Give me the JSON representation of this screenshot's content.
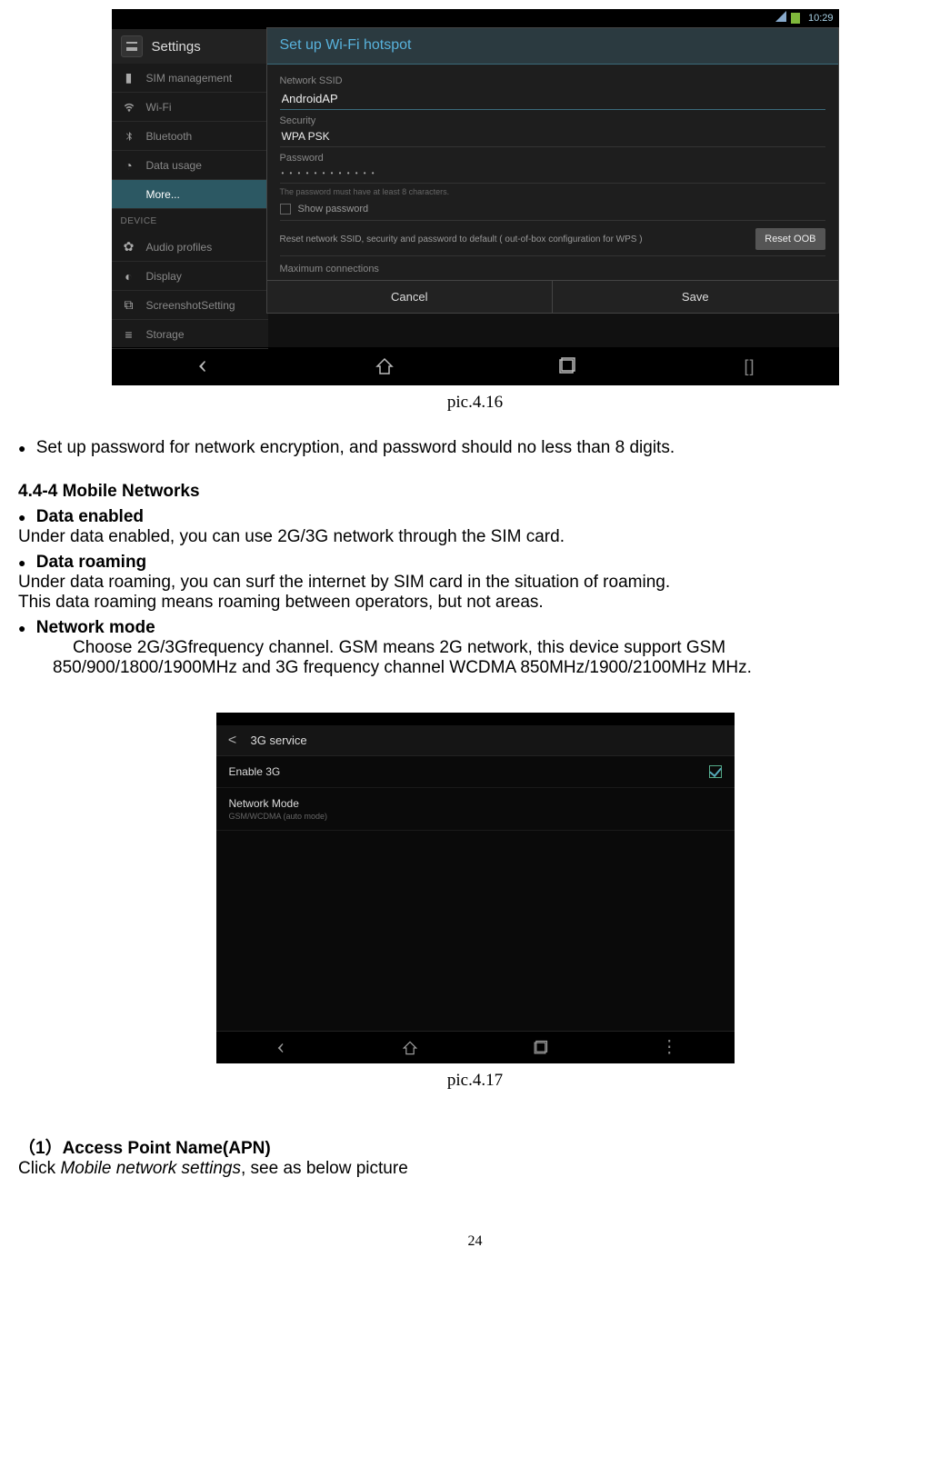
{
  "screenshot1": {
    "statusbar": {
      "time": "10:29"
    },
    "sidebar": {
      "title": "Settings",
      "items": [
        {
          "label": "SIM management",
          "icon": "sim-icon"
        },
        {
          "label": "Wi-Fi",
          "icon": "wifi-icon"
        },
        {
          "label": "Bluetooth",
          "icon": "bluetooth-icon"
        },
        {
          "label": "Data usage",
          "icon": "data-usage-icon"
        },
        {
          "label": "More...",
          "icon": "",
          "active": true
        }
      ],
      "section_device": "DEVICE",
      "items2": [
        {
          "label": "Audio profiles",
          "icon": "audio-icon"
        },
        {
          "label": "Display",
          "icon": "display-icon"
        },
        {
          "label": "ScreenshotSetting",
          "icon": "screenshot-icon"
        },
        {
          "label": "Storage",
          "icon": "storage-icon"
        }
      ]
    },
    "dialog": {
      "title": "Set up Wi-Fi hotspot",
      "ssid_label": "Network SSID",
      "ssid_value": "AndroidAP",
      "security_label": "Security",
      "security_value": "WPA PSK",
      "password_label": "Password",
      "password_dots": "• • • • • • • • • • • •",
      "password_hint": "The password must have at least 8 characters.",
      "show_password": "Show password",
      "reset_text": "Reset network SSID, security and password to default ( out-of-box configuration for WPS )",
      "reset_btn": "Reset OOB",
      "max_conn": "Maximum connections",
      "cancel": "Cancel",
      "save": "Save"
    }
  },
  "caption1": "pic.4.16",
  "text": {
    "setup_pwd": "Set up password for network encryption, and password should no less than 8 digits.",
    "heading_mobile": "4.4-4 Mobile Networks",
    "data_enabled_h": "Data enabled",
    "data_enabled_b": "Under data enabled, you can use 2G/3G network through the SIM card.",
    "data_roaming_h": "Data roaming",
    "data_roaming_b1": "Under data roaming, you can surf the internet by SIM card in the situation of roaming.",
    "data_roaming_b2": "This data roaming means roaming between operators, but not areas.",
    "network_mode_h": "Network mode",
    "network_mode_b1": "Choose 2G/3Gfrequency channel. GSM means 2G network, this device support GSM",
    "network_mode_b2": "850/900/1800/1900MHz and 3G frequency channel WCDMA 850MHz/1900/2100MHz MHz."
  },
  "screenshot2": {
    "back_icon": "<",
    "title": "3G service",
    "row1": {
      "label": "Enable 3G"
    },
    "row2": {
      "label": "Network Mode",
      "sub": "GSM/WCDMA (auto mode)"
    }
  },
  "caption2": "pic.4.17",
  "apn": {
    "heading": "（1）Access Point Name(APN)",
    "body_prefix": "Click ",
    "body_italic": "Mobile network settings",
    "body_suffix": ", see as below picture"
  },
  "page_number": "24"
}
